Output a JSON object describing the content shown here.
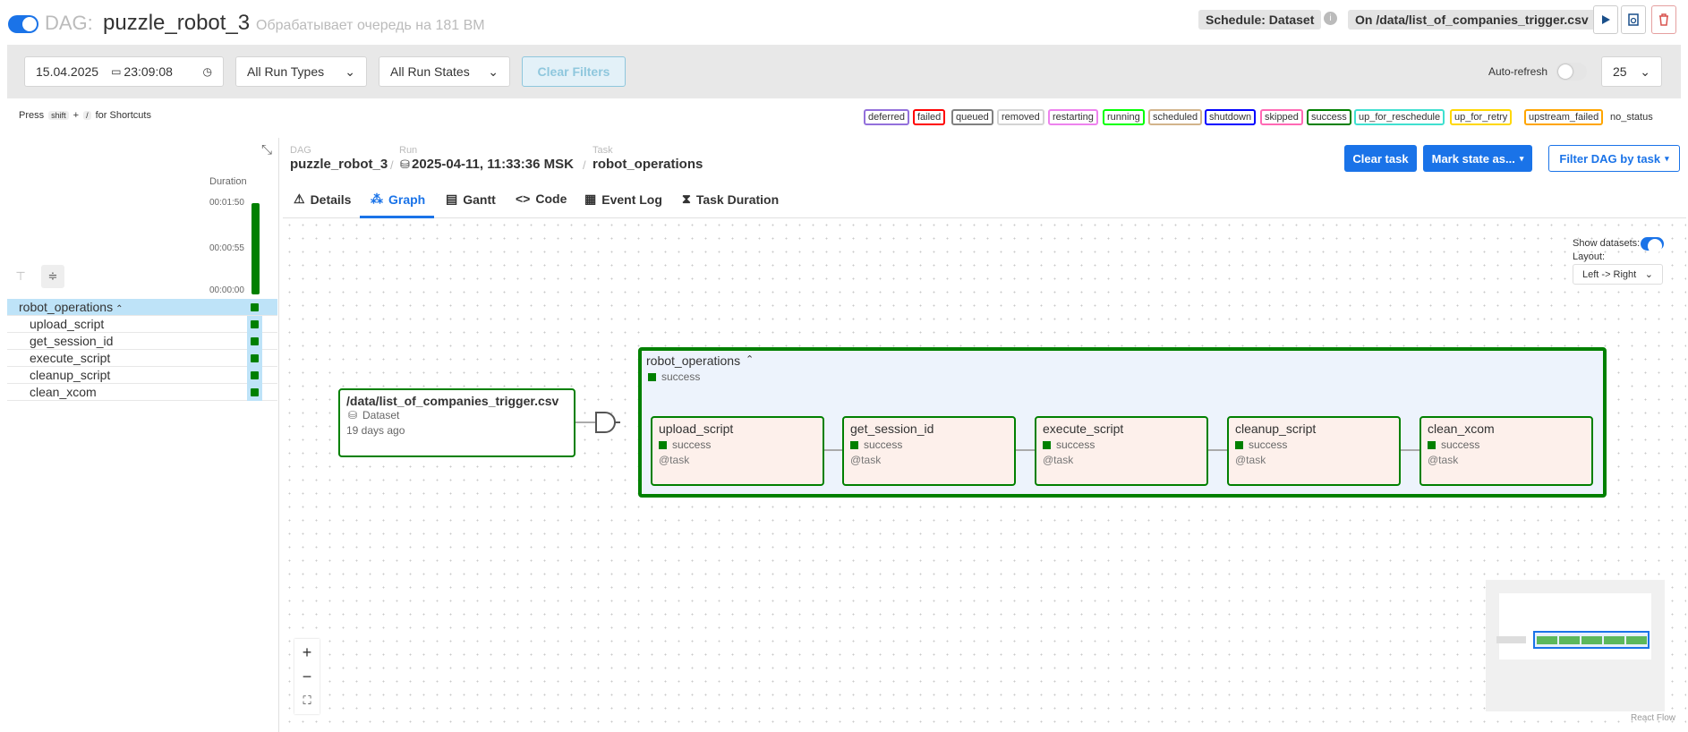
{
  "header": {
    "dag_prefix": "DAG:",
    "dag_name": "puzzle_robot_3",
    "subtitle": "Обрабатывает очередь на 181 ВМ",
    "schedule": "Schedule: Dataset",
    "trigger": "On /data/list_of_companies_trigger.csv"
  },
  "filters": {
    "date": "15.04.2025",
    "time": "23:09:08",
    "run_types": "All Run Types",
    "run_states": "All Run States",
    "clear": "Clear Filters",
    "autorefresh_label": "Auto-refresh",
    "page_size": "25"
  },
  "shortcuts": {
    "press": "Press",
    "key1": "shift",
    "plus": "+",
    "key2": "/",
    "suffix": "for Shortcuts"
  },
  "legend": [
    {
      "label": "deferred",
      "color": "#9370db"
    },
    {
      "label": "failed",
      "color": "#ff0000"
    },
    {
      "label": "queued",
      "color": "#808080"
    },
    {
      "label": "removed",
      "color": "#d3d3d3"
    },
    {
      "label": "restarting",
      "color": "#ee82ee"
    },
    {
      "label": "running",
      "color": "#00ff00"
    },
    {
      "label": "scheduled",
      "color": "#d2b48c"
    },
    {
      "label": "shutdown",
      "color": "#0000ff"
    },
    {
      "label": "skipped",
      "color": "#ff69b4"
    },
    {
      "label": "success",
      "color": "#008000"
    },
    {
      "label": "up_for_reschedule",
      "color": "#40e0d0"
    },
    {
      "label": "up_for_retry",
      "color": "#ffd700"
    },
    {
      "label": "upstream_failed",
      "color": "#ffa500"
    },
    {
      "label": "no_status",
      "color": "#ffffff"
    }
  ],
  "grid": {
    "duration_label": "Duration",
    "ticks": [
      "00:01:50",
      "00:00:55",
      "00:00:00"
    ],
    "group": "robot_operations",
    "tasks": [
      "upload_script",
      "get_session_id",
      "execute_script",
      "cleanup_script",
      "clean_xcom"
    ]
  },
  "breadcrumb": {
    "dag_label": "DAG",
    "dag": "puzzle_robot_3",
    "run_label": "Run",
    "run": "2025-04-11, 11:33:36 MSK",
    "task_label": "Task",
    "task": "robot_operations"
  },
  "actions": {
    "clear_task": "Clear task",
    "mark_state": "Mark state as...",
    "filter_dag": "Filter DAG by task"
  },
  "tabs": [
    "Details",
    "Graph",
    "Gantt",
    "Code",
    "Event Log",
    "Task Duration"
  ],
  "graph": {
    "show_datasets": "Show datasets:",
    "layout_label": "Layout:",
    "layout_value": "Left -> Right",
    "dataset": {
      "name": "/data/list_of_companies_trigger.csv",
      "type": "Dataset",
      "age": "19 days ago"
    },
    "group": {
      "name": "robot_operations",
      "state": "success"
    },
    "nodes": [
      {
        "name": "upload_script",
        "state": "success",
        "op": "@task"
      },
      {
        "name": "get_session_id",
        "state": "success",
        "op": "@task"
      },
      {
        "name": "execute_script",
        "state": "success",
        "op": "@task"
      },
      {
        "name": "cleanup_script",
        "state": "success",
        "op": "@task"
      },
      {
        "name": "clean_xcom",
        "state": "success",
        "op": "@task"
      }
    ],
    "attribution": "React Flow",
    "zoom_in": "+",
    "zoom_out": "−",
    "fit": "⛶"
  },
  "colors": {
    "success": "#008000",
    "accent": "#1a73e8"
  }
}
